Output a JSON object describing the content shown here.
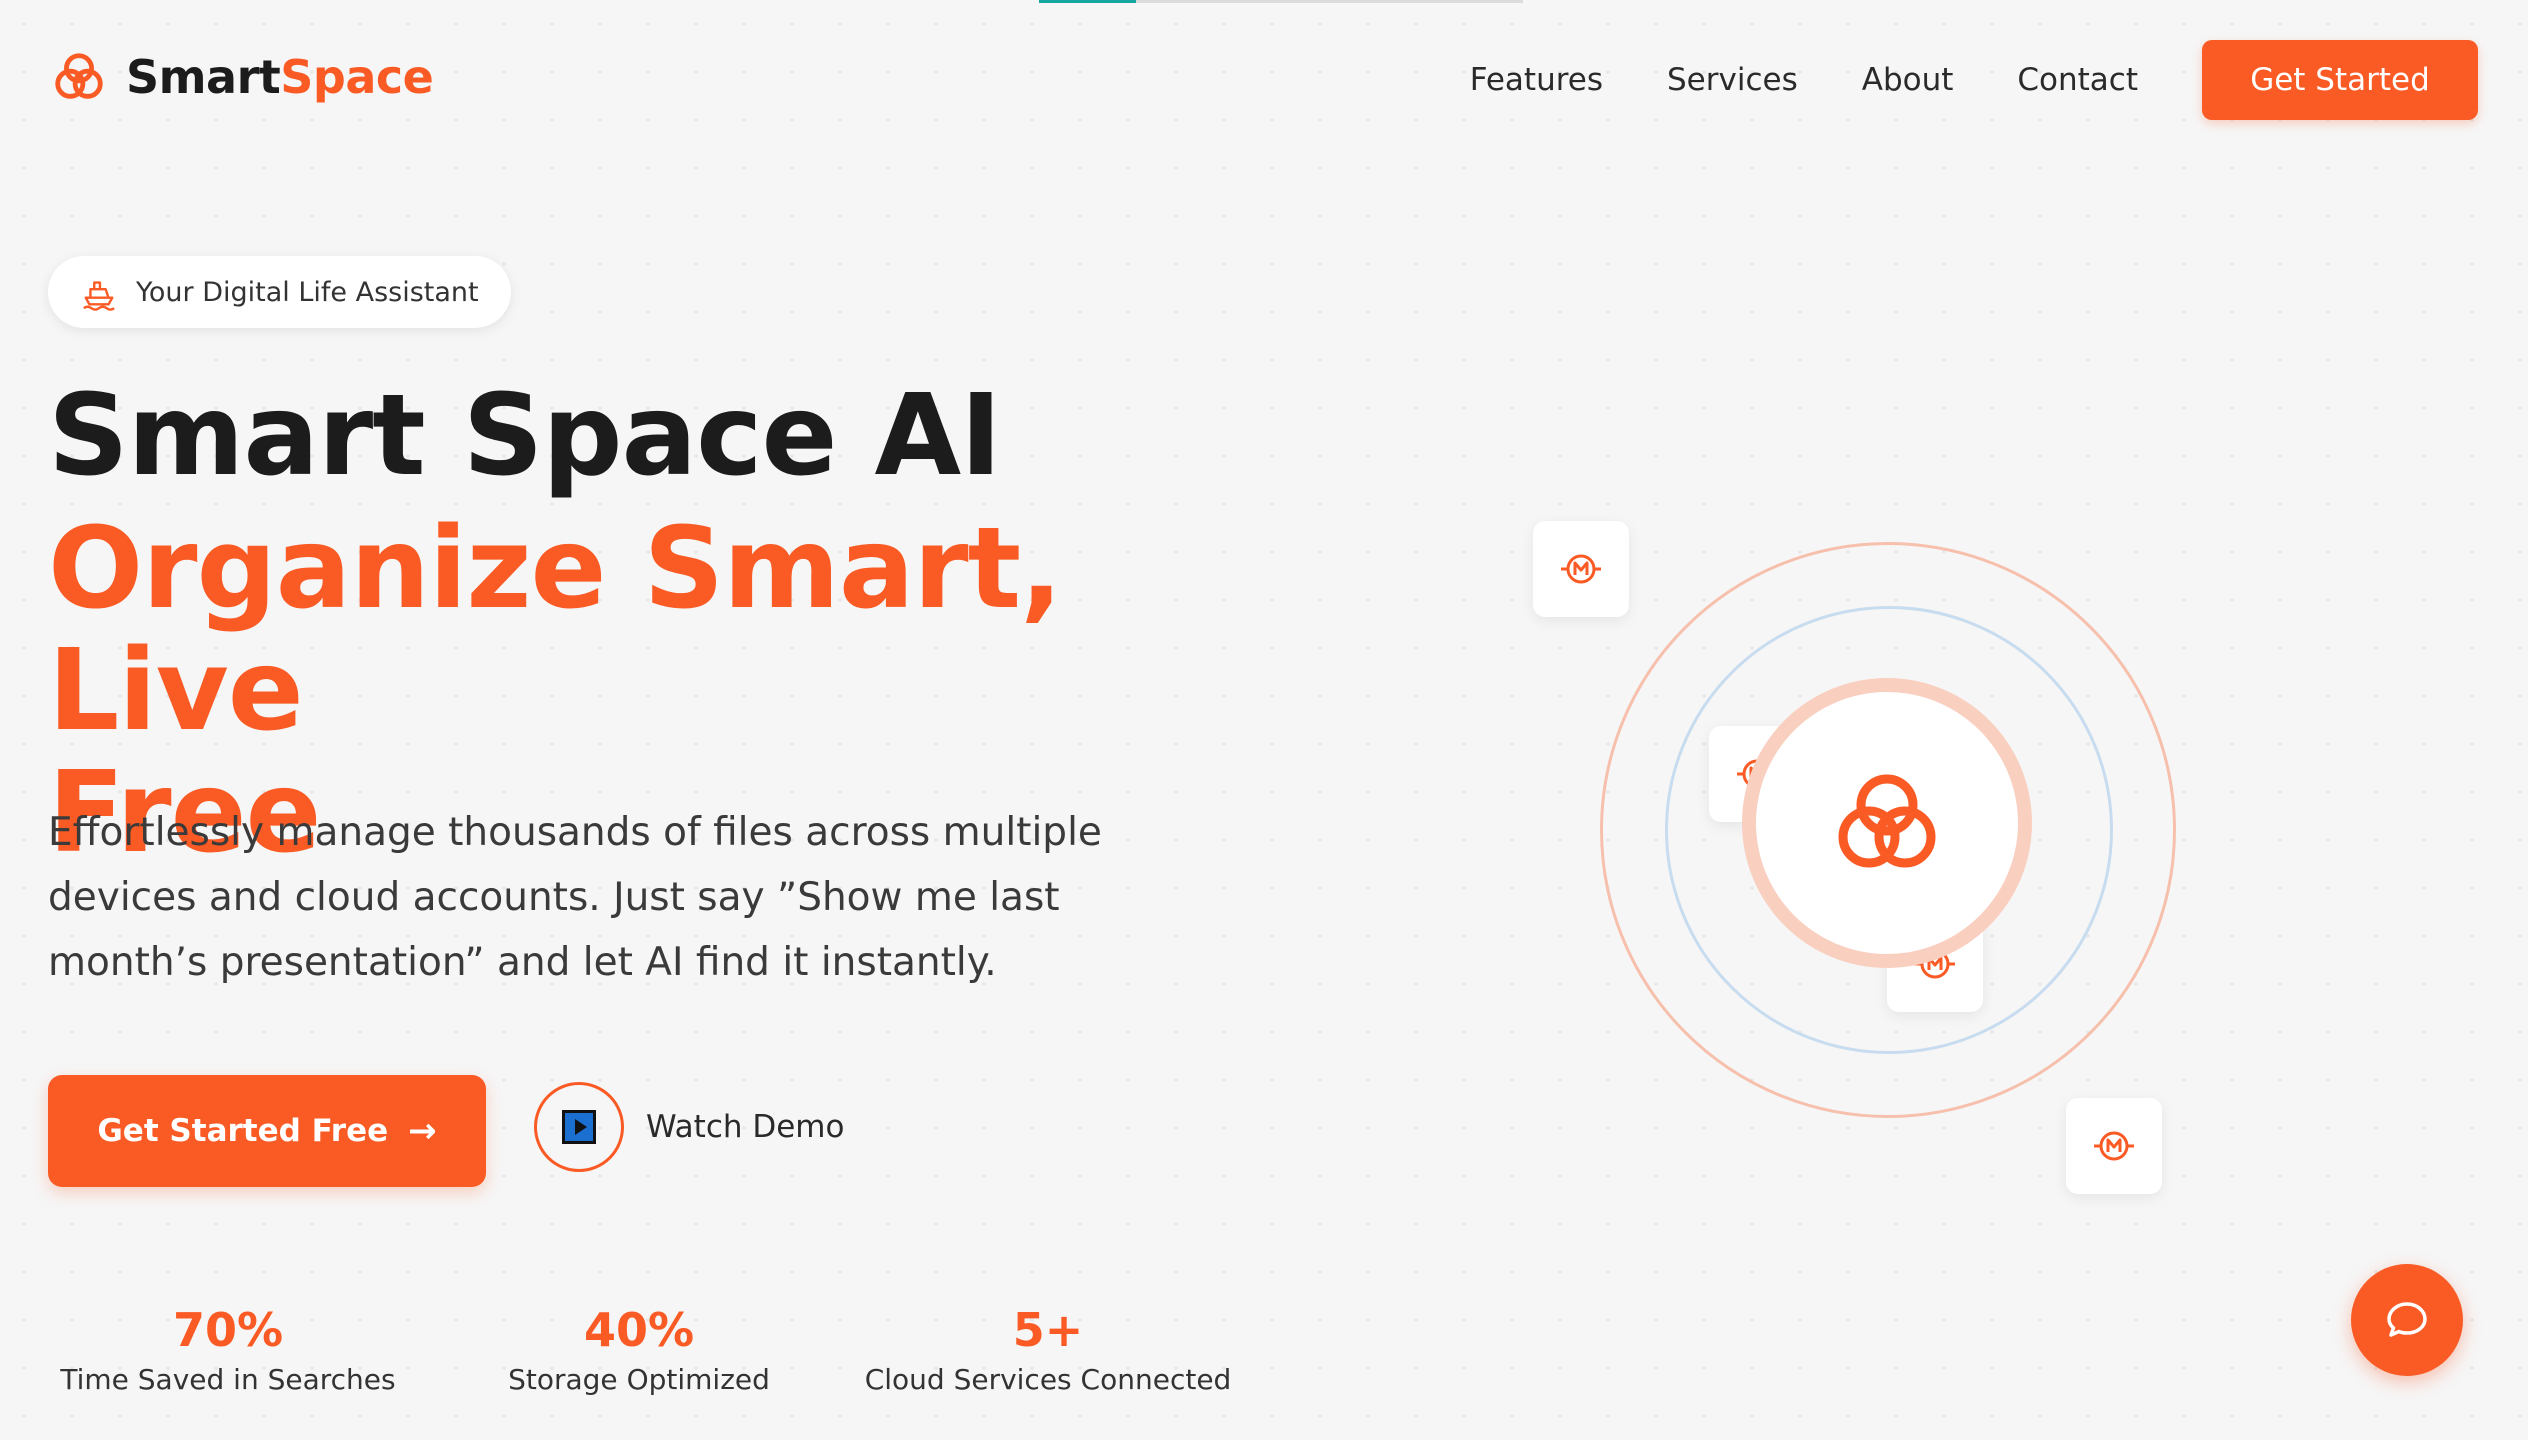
{
  "progress": {
    "fraction": 0.2
  },
  "brand": {
    "name_dark": "Smart",
    "name_accent": "Space",
    "logo_icon": "triple-ring-logo-icon",
    "accent_color": "#fa5a24"
  },
  "nav": {
    "links": [
      "Features",
      "Services",
      "About",
      "Contact"
    ],
    "cta": "Get Started"
  },
  "hero": {
    "badge": {
      "icon": "ship-icon",
      "text": "Your Digital Life Assistant"
    },
    "title": "Smart Space AI",
    "subtitle_line1": "Organize Smart, Live",
    "subtitle_line2": "Free",
    "description": "Effortlessly manage thousands of files across multiple devices and cloud accounts. Just say ”Show me last month’s presentation” and let AI find it instantly.",
    "primary_cta": "Get Started Free",
    "primary_cta_icon": "arrow-right-icon",
    "secondary_cta": "Watch Demo",
    "secondary_cta_icon": "play-icon"
  },
  "stats": [
    {
      "value": "70%",
      "label": "Time Saved in Searches"
    },
    {
      "value": "40%",
      "label": "Storage Optimized"
    },
    {
      "value": "5+",
      "label": "Cloud Services Connected"
    }
  ],
  "orbit": {
    "tile_icon": "gauge-icon",
    "core_icon": "triple-ring-logo-icon"
  },
  "chat": {
    "icon": "chat-bubble-icon"
  }
}
